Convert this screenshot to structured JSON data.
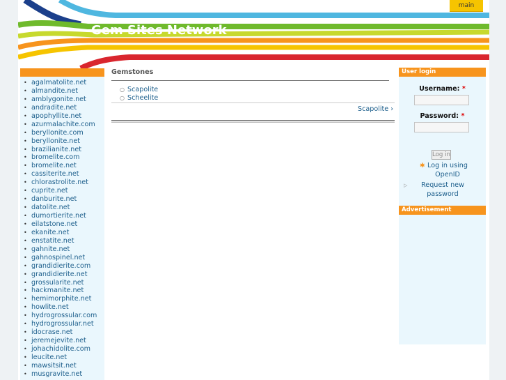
{
  "header": {
    "site_title": "Gem Sites Network",
    "main_tab": "main"
  },
  "sidebar_left": {
    "items": [
      "agalmatolite.net",
      "almandite.net",
      "amblygonite.net",
      "andradite.net",
      "apophyllite.net",
      "azurmalachite.com",
      "beryllonite.com",
      "beryllonite.net",
      "brazilianite.net",
      "bromelite.com",
      "bromelite.net",
      "cassiterite.net",
      "chlorastrolite.net",
      "cuprite.net",
      "danburite.net",
      "datolite.net",
      "dumortierite.net",
      "eilatstone.net",
      "ekanite.net",
      "enstatite.net",
      "gahnite.net",
      "gahnospinel.net",
      "grandidierite.com",
      "grandidierite.net",
      "grossularite.net",
      "hackmanite.net",
      "hemimorphite.net",
      "howlite.net",
      "hydrogrossular.com",
      "hydrogrossular.net",
      "idocrase.net",
      "jeremejevite.net",
      "johachidolite.com",
      "leucite.net",
      "mawsitsit.net",
      "musgravite.net"
    ]
  },
  "main": {
    "title": "Gemstones",
    "book_items": [
      "Scapolite",
      "Scheelite"
    ],
    "next_link": "Scapolite ›"
  },
  "login": {
    "title": "User login",
    "username_label": "Username:",
    "password_label": "Password:",
    "required_mark": "*",
    "login_button": "Log in",
    "openid_link": "Log in using OpenID",
    "request_password": "Request new password"
  },
  "advertisement": {
    "title": "Advertisement"
  },
  "colors": {
    "accent_orange": "#f7941d",
    "link_blue": "#1d5f8c",
    "panel_light_blue": "#eaf7fd",
    "tab_yellow": "#f6c400"
  }
}
